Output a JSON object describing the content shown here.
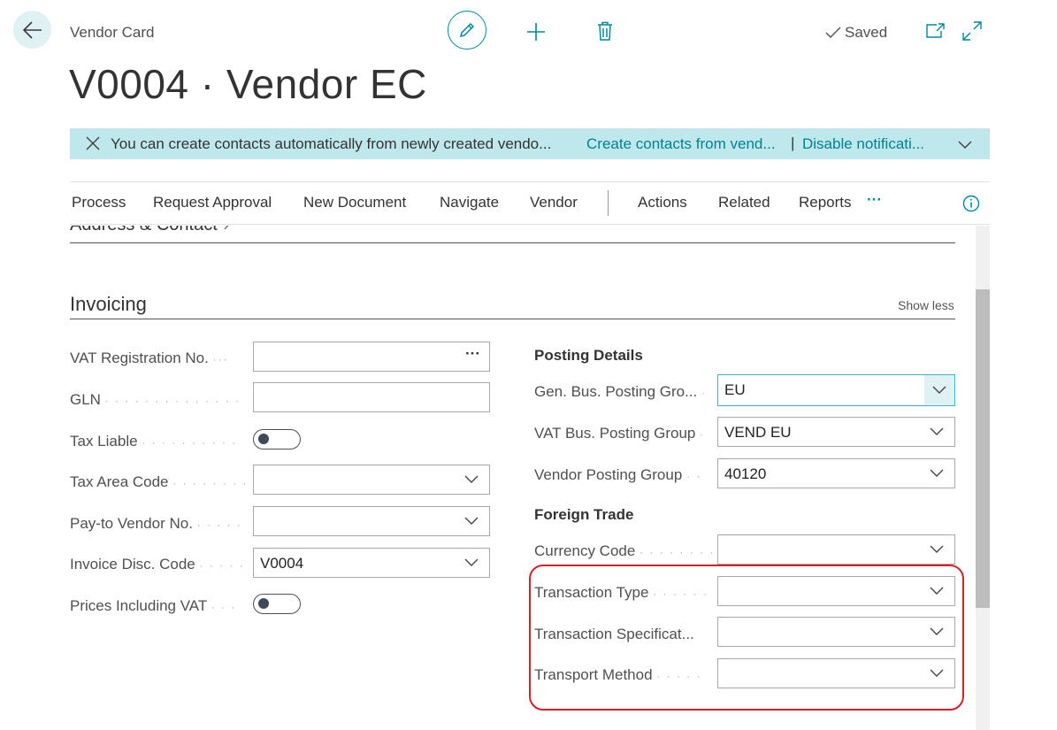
{
  "header": {
    "breadcrumb": "Vendor Card",
    "title": "V0004 · Vendor EC",
    "saved_label": "Saved"
  },
  "notification": {
    "message": "You can create contacts automatically from newly created vendo...",
    "link_create": "Create contacts from vend...",
    "separator": "|",
    "link_disable": "Disable notificati..."
  },
  "actions": {
    "process": "Process",
    "request_approval": "Request Approval",
    "new_document": "New Document",
    "navigate": "Navigate",
    "vendor": "Vendor",
    "actions": "Actions",
    "related": "Related",
    "reports": "Reports",
    "more": "···"
  },
  "sections": {
    "address_contact": "Address & Contact",
    "invoicing": "Invoicing",
    "show_less": "Show less"
  },
  "left_fields": {
    "vat_registration_no": {
      "label": "VAT Registration No.",
      "value": "",
      "more": "···"
    },
    "gln": {
      "label": "GLN",
      "value": ""
    },
    "tax_liable": {
      "label": "Tax Liable",
      "value": "off"
    },
    "tax_area_code": {
      "label": "Tax Area Code",
      "value": ""
    },
    "pay_to_vendor_no": {
      "label": "Pay-to Vendor No.",
      "value": ""
    },
    "invoice_disc_code": {
      "label": "Invoice Disc. Code",
      "value": "V0004"
    },
    "prices_including_vat": {
      "label": "Prices Including VAT",
      "value": "off"
    }
  },
  "posting_details": {
    "title": "Posting Details",
    "gen_bus_posting_group": {
      "label": "Gen. Bus. Posting Gro...",
      "value": "EU"
    },
    "vat_bus_posting_group": {
      "label": "VAT Bus. Posting Group",
      "value": "VEND EU"
    },
    "vendor_posting_group": {
      "label": "Vendor Posting Group",
      "value": "40120"
    }
  },
  "foreign_trade": {
    "title": "Foreign Trade",
    "currency_code": {
      "label": "Currency Code",
      "value": ""
    },
    "transaction_type": {
      "label": "Transaction Type",
      "value": ""
    },
    "transaction_specification": {
      "label": "Transaction Specificat...",
      "value": ""
    },
    "transport_method": {
      "label": "Transport Method",
      "value": ""
    }
  },
  "colors": {
    "accent": "#00889a",
    "notification_bg": "#bfe8ec",
    "highlight_border": "#d0202a"
  },
  "icons": [
    "back-arrow-icon",
    "pencil-icon",
    "plus-icon",
    "trash-icon",
    "checkmark-icon",
    "open-new-window-icon",
    "expand-icon",
    "close-icon",
    "chevron-down-icon",
    "info-icon",
    "chevron-right-icon"
  ]
}
